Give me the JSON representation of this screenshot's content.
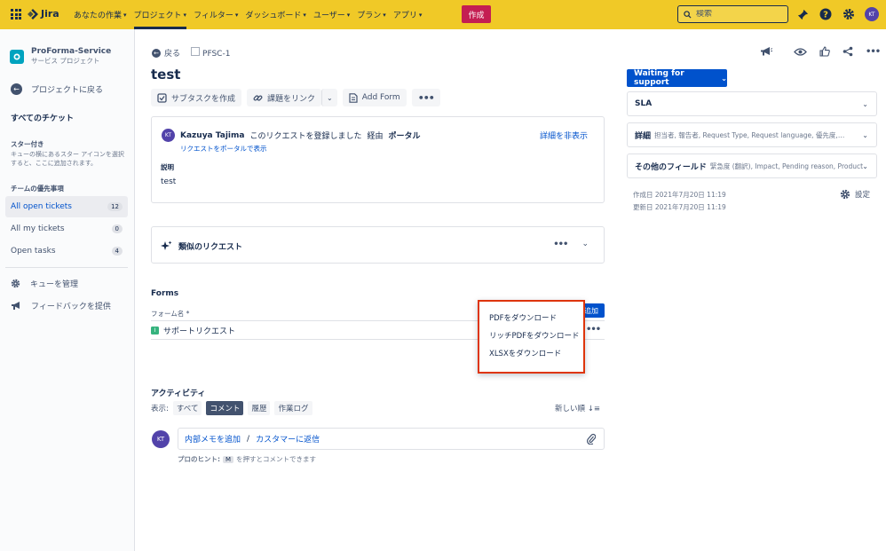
{
  "topnav": {
    "brand": "Jira",
    "items": [
      {
        "label": "あなたの作業",
        "active": false
      },
      {
        "label": "プロジェクト",
        "active": true
      },
      {
        "label": "フィルター",
        "active": false
      },
      {
        "label": "ダッシュボード",
        "active": false
      },
      {
        "label": "ユーザー",
        "active": false
      },
      {
        "label": "プラン",
        "active": false
      },
      {
        "label": "アプリ",
        "active": false
      }
    ],
    "create_label": "作成",
    "search_placeholder": "検索",
    "avatar_initials": "KT",
    "colors": {
      "bar": "#f0c927",
      "create": "#c41e52"
    }
  },
  "sidebar": {
    "project_name": "ProForma-Service",
    "project_type": "サービス プロジェクト",
    "back_label": "プロジェクトに戻る",
    "all_tickets": "すべてのチケット",
    "starred_heading": "スター付き",
    "starred_help": "キューの横にあるスター アイコンを選択すると、ここに追加されます。",
    "priority_heading": "チームの優先事項",
    "queues": [
      {
        "label": "All open tickets",
        "count": "12",
        "active": true
      },
      {
        "label": "All my tickets",
        "count": "0",
        "active": false
      },
      {
        "label": "Open tasks",
        "count": "4",
        "active": false
      }
    ],
    "manage_queues": "キューを管理",
    "feedback": "フィードバックを提供"
  },
  "issue": {
    "back_label": "戻る",
    "key": "PFSC-1",
    "title": "test",
    "toolbar": {
      "subtask": "サブタスクを作成",
      "link": "課題をリンク",
      "add_form": "Add Form"
    },
    "request": {
      "avatar": "KT",
      "reporter": "Kazuya Tajima",
      "action": "このリクエストを登録しました",
      "via": "経由",
      "channel": "ポータル",
      "view_portal": "リクエストをポータルで表示",
      "hide_details": "詳細を非表示",
      "description_label": "説明",
      "description": "test"
    },
    "similar": {
      "title": "類似のリクエスト"
    },
    "forms": {
      "heading": "Forms",
      "column": "フォーム名 *",
      "add_label": "追加",
      "rows": [
        {
          "name": "サポートリクエスト",
          "icon": "I"
        }
      ],
      "menu": [
        "PDFをダウンロード",
        "リッチPDFをダウンロード",
        "XLSXをダウンロード"
      ]
    },
    "activity": {
      "heading": "アクティビティ",
      "show_label": "表示:",
      "filters": [
        {
          "label": "すべて",
          "active": false
        },
        {
          "label": "コメント",
          "active": true
        },
        {
          "label": "履歴",
          "active": false
        },
        {
          "label": "作業ログ",
          "active": false
        }
      ],
      "sort": "新しい順",
      "avatar": "KT",
      "internal_note": "内部メモを追加",
      "separator": "/",
      "reply": "カスタマーに返信",
      "hint_prefix": "プロのヒント:",
      "hint_key": "M",
      "hint_suffix": "を押すとコメントできます"
    }
  },
  "details": {
    "status": "Waiting for support",
    "panels": [
      {
        "title": "SLA",
        "sub": ""
      },
      {
        "title": "詳細",
        "sub": "担当者, 報告者, Request Type, Request language, 優先度, ラベル"
      },
      {
        "title": "その他のフィールド",
        "sub": "緊急度 (翻訳), Impact, Pending reason, Product"
      }
    ],
    "created": "作成日 2021年7月20日 11:19",
    "updated": "更新日 2021年7月20日 11:19",
    "settings": "設定",
    "status_color": "#0052cc"
  }
}
